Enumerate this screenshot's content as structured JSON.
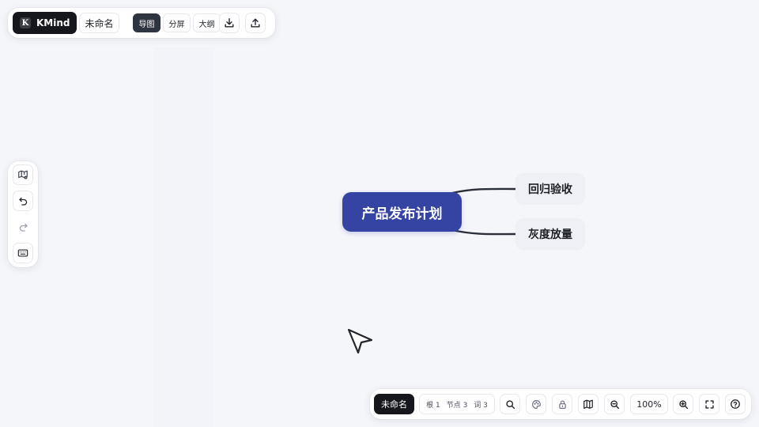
{
  "topbar": {
    "brand": "KMind",
    "brand_logo_letter": "K",
    "doc_name": "未命名",
    "modes": [
      "导图",
      "分屏",
      "大纲"
    ],
    "active_mode": "导图",
    "download_icon": "download-icon",
    "upload_icon": "upload-icon"
  },
  "leftbar": {
    "icons": [
      "map-settings-icon",
      "undo-icon",
      "redo-icon",
      "keyboard-icon"
    ]
  },
  "mindmap": {
    "root": "产品发布计划",
    "children": [
      "回归验收",
      "灰度放量"
    ],
    "root_color": "#3543a3"
  },
  "bottombar": {
    "doc_name": "未命名",
    "stats": {
      "roots": "根 1",
      "nodes": "节点 3",
      "words": "词 3"
    },
    "zoom": "100%",
    "icons": [
      "search-icon",
      "theme-icon",
      "lock-icon",
      "map-icon",
      "zoom-out-icon",
      "zoom-in-icon",
      "fullscreen-icon",
      "help-icon"
    ]
  }
}
